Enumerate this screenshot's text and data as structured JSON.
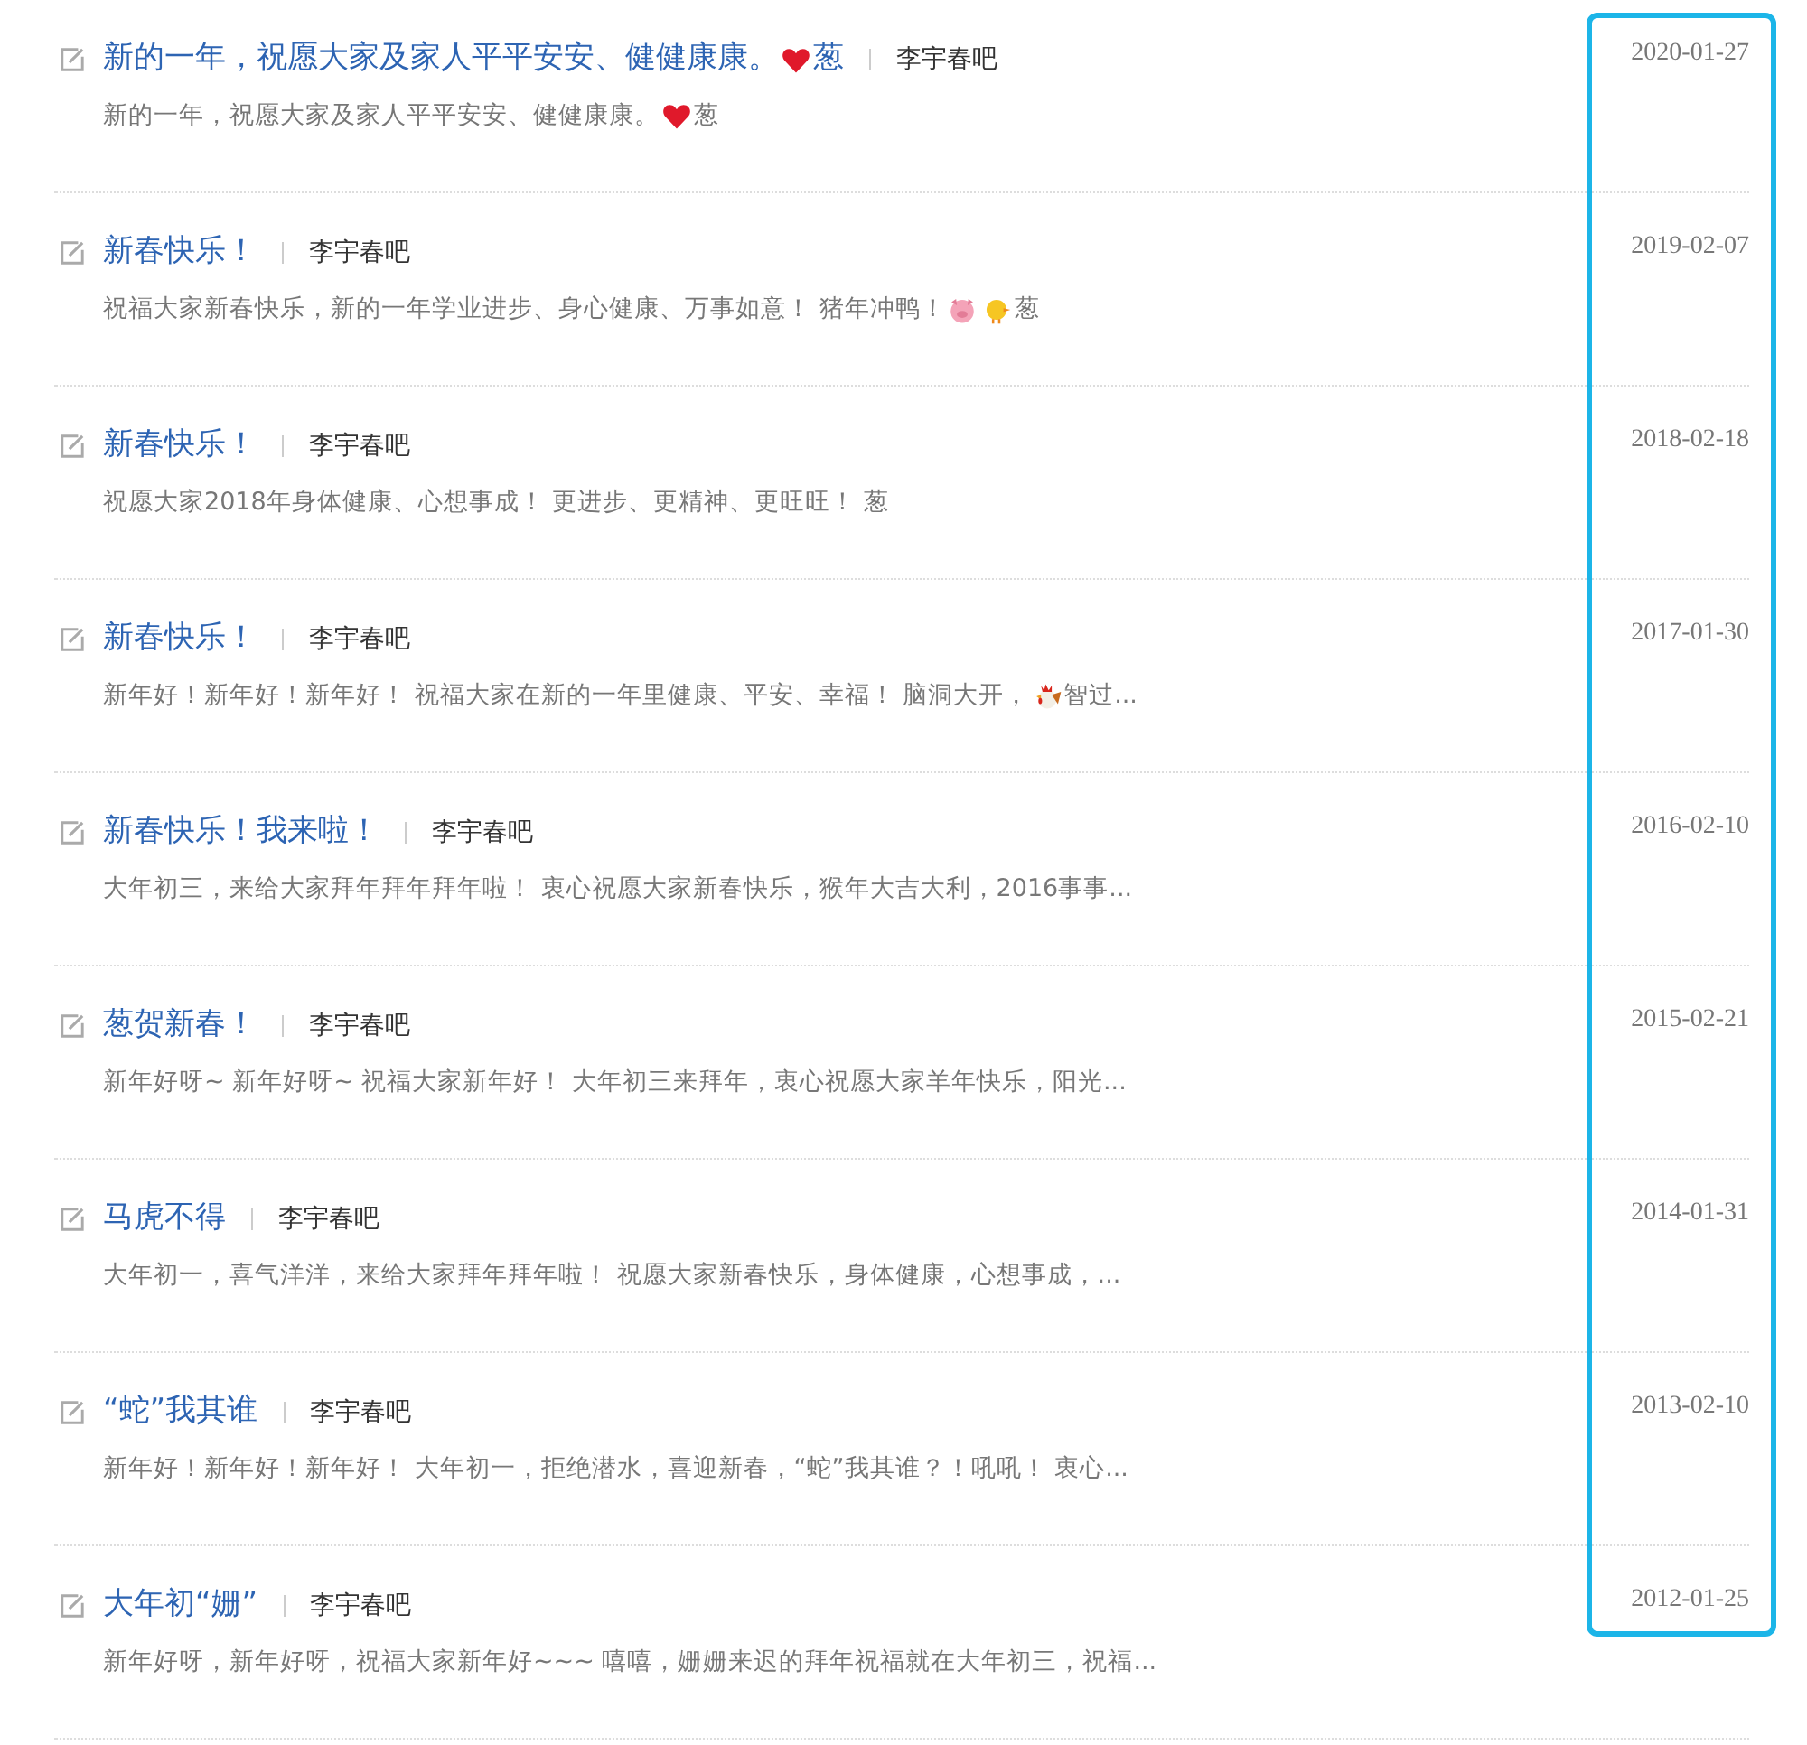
{
  "posts": [
    {
      "title": [
        {
          "kind": "text",
          "text": "新的一年，祝愿大家及家人平平安安、健健康康。"
        },
        {
          "kind": "heart"
        },
        {
          "kind": "text",
          "text": "葱"
        }
      ],
      "source": "李宇春吧",
      "excerpt": [
        {
          "kind": "text",
          "text": "新的一年，祝愿大家及家人平平安安、健健康康。"
        },
        {
          "kind": "heart"
        },
        {
          "kind": "text",
          "text": " 葱"
        }
      ],
      "date": "2020-01-27"
    },
    {
      "title": [
        {
          "kind": "text",
          "text": "新春快乐！"
        }
      ],
      "source": "李宇春吧",
      "excerpt": [
        {
          "kind": "text",
          "text": "祝福大家新春快乐，新的一年学业进步、身心健康、万事如意！ 猪年冲鸭！"
        },
        {
          "kind": "pig"
        },
        {
          "kind": "chick"
        },
        {
          "kind": "text",
          "text": " 葱"
        }
      ],
      "date": "2019-02-07"
    },
    {
      "title": [
        {
          "kind": "text",
          "text": "新春快乐！"
        }
      ],
      "source": "李宇春吧",
      "excerpt": [
        {
          "kind": "text",
          "text": "祝愿大家2018年身体健康、心想事成！ 更进步、更精神、更旺旺！ 葱"
        }
      ],
      "date": "2018-02-18"
    },
    {
      "title": [
        {
          "kind": "text",
          "text": "新春快乐！"
        }
      ],
      "source": "李宇春吧",
      "excerpt": [
        {
          "kind": "text",
          "text": "新年好！新年好！新年好！ 祝福大家在新的一年里健康、平安、幸福！ 脑洞大开，"
        },
        {
          "kind": "rooster"
        },
        {
          "kind": "text",
          "text": "智过..."
        }
      ],
      "date": "2017-01-30"
    },
    {
      "title": [
        {
          "kind": "text",
          "text": "新春快乐！我来啦！"
        }
      ],
      "source": "李宇春吧",
      "excerpt": [
        {
          "kind": "text",
          "text": "大年初三，来给大家拜年拜年拜年啦！ 衷心祝愿大家新春快乐，猴年大吉大利，2016事事..."
        }
      ],
      "date": "2016-02-10"
    },
    {
      "title": [
        {
          "kind": "text",
          "text": "葱贺新春！"
        }
      ],
      "source": "李宇春吧",
      "excerpt": [
        {
          "kind": "text",
          "text": "新年好呀~ 新年好呀~ 祝福大家新年好！ 大年初三来拜年，衷心祝愿大家羊年快乐，阳光..."
        }
      ],
      "date": "2015-02-21"
    },
    {
      "title": [
        {
          "kind": "text",
          "text": "马虎不得"
        }
      ],
      "source": "李宇春吧",
      "excerpt": [
        {
          "kind": "text",
          "text": "大年初一，喜气洋洋，来给大家拜年拜年啦！ 祝愿大家新春快乐，身体健康，心想事成，..."
        }
      ],
      "date": "2014-01-31"
    },
    {
      "title": [
        {
          "kind": "text",
          "text": "“蛇”我其谁"
        }
      ],
      "source": "李宇春吧",
      "excerpt": [
        {
          "kind": "text",
          "text": "新年好！新年好！新年好！ 大年初一，拒绝潜水，喜迎新春，“蛇”我其谁？！吼吼！ 衷心..."
        }
      ],
      "date": "2013-02-10"
    },
    {
      "title": [
        {
          "kind": "text",
          "text": "大年初“姗”"
        }
      ],
      "source": "李宇春吧",
      "excerpt": [
        {
          "kind": "text",
          "text": "新年好呀，新年好呀，祝福大家新年好~~~ 嘻嘻，姗姗来迟的拜年祝福就在大年初三，祝福..."
        }
      ],
      "date": "2012-01-25"
    }
  ]
}
